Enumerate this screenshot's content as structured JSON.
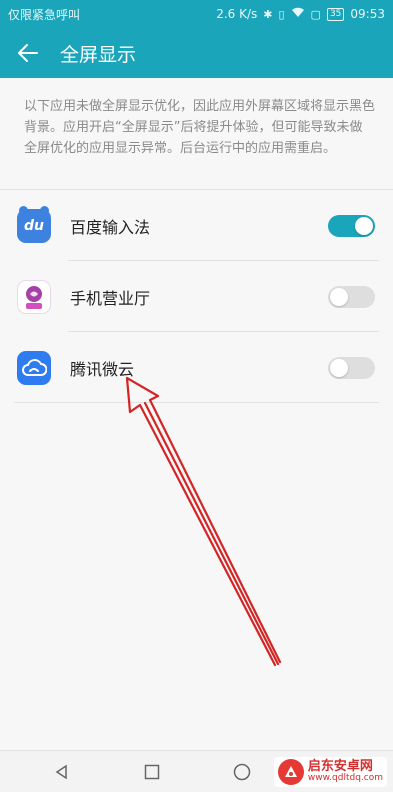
{
  "status_bar": {
    "carrier_text": "仅限紧急呼叫",
    "net_speed": "2.6 K/s",
    "battery": "35",
    "time": "09:53"
  },
  "app_bar": {
    "title": "全屏显示",
    "back_icon": "arrow-left-icon"
  },
  "description": "以下应用未做全屏显示优化，因此应用外屏幕区域将显示黑色背景。应用开启“全屏显示”后将提升体验，但可能导致未做全屏优化的应用显示异常。后台运行中的应用需重启。",
  "apps": [
    {
      "name": "百度输入法",
      "icon": "baidu-input-icon",
      "enabled": true
    },
    {
      "name": "手机营业厅",
      "icon": "unicom-icon",
      "enabled": false
    },
    {
      "name": "腾讯微云",
      "icon": "weiyun-icon",
      "enabled": false
    }
  ],
  "icon_text": {
    "baidu": "du"
  },
  "colors": {
    "accent": "#1aa5ba",
    "annotation_arrow": "#d42424"
  },
  "watermark": {
    "name": "启东安卓网",
    "url": "www.qdltdq.com"
  }
}
